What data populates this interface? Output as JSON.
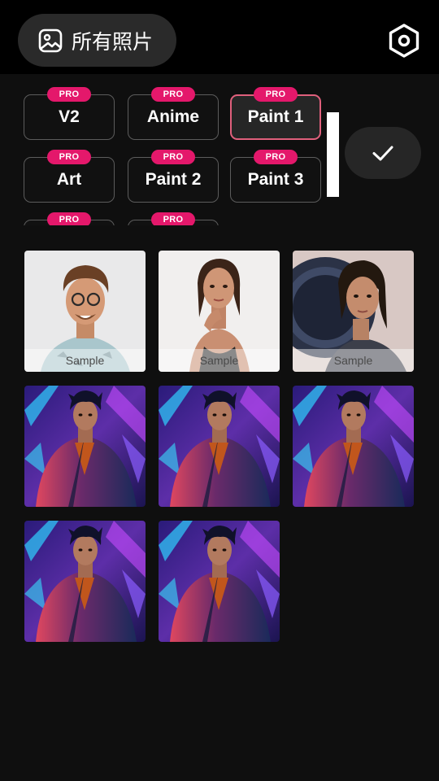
{
  "header": {
    "album_label": "所有照片",
    "album_icon": "image-icon",
    "settings_icon": "hexagon-settings-icon"
  },
  "styles": {
    "badge_label": "PRO",
    "items": [
      {
        "label": "V2",
        "selected": false
      },
      {
        "label": "Anime",
        "selected": false
      },
      {
        "label": "Paint 1",
        "selected": true
      },
      {
        "label": "Art",
        "selected": false
      },
      {
        "label": "Paint 2",
        "selected": false
      },
      {
        "label": "Paint 3",
        "selected": false
      },
      {
        "label": "",
        "selected": false
      },
      {
        "label": "",
        "selected": false
      }
    ],
    "confirm_icon": "checkmark-icon"
  },
  "photos": {
    "sample_label": "Sample",
    "items": [
      {
        "kind": "sample",
        "desc_icon": "portrait-man-glasses"
      },
      {
        "kind": "sample",
        "desc_icon": "portrait-woman"
      },
      {
        "kind": "sample",
        "desc_icon": "portrait-woman-ring-light"
      },
      {
        "kind": "photo",
        "desc_icon": "neon-portrait"
      },
      {
        "kind": "photo",
        "desc_icon": "neon-portrait"
      },
      {
        "kind": "photo",
        "desc_icon": "neon-portrait"
      },
      {
        "kind": "photo",
        "desc_icon": "neon-portrait"
      },
      {
        "kind": "photo",
        "desc_icon": "neon-portrait"
      }
    ]
  },
  "colors": {
    "accent_pink": "#e4186b",
    "selected_border": "#e0607c",
    "background": "#0f0f0f"
  }
}
